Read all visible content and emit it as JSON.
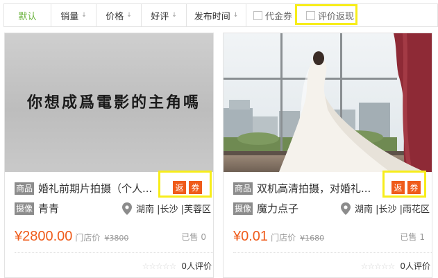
{
  "sort_bar": {
    "default": "默认",
    "sales": "销量",
    "price": "价格",
    "rating": "好评",
    "publish_time": "发布时间",
    "voucher": "代金券",
    "review_cashback": "评价返现"
  },
  "icons": {
    "sort_arrow": "↓",
    "location_pin": "location-pin-icon",
    "star": "☆☆☆☆☆"
  },
  "colors": {
    "accent_green": "#6ab33c",
    "price_orange": "#ef5b1a",
    "highlight_yellow": "#f7ed1a",
    "tag_gray": "#8c8c8c"
  },
  "products": [
    {
      "image_text": "你想成爲電影的主角嗎",
      "tag_product": "商品",
      "title": "婚礼前期片拍摄（个人...",
      "badge_return": "返",
      "badge_coupon": "券",
      "tag_photo": "摄像",
      "shop": "青青",
      "location": "湖南 |长沙 |芙蓉区",
      "price": "¥2800.00",
      "price_label": "门店价",
      "original_price": "¥3800",
      "sold_label": "已售",
      "sold_count": "0",
      "stars": "☆☆☆☆☆",
      "reviews": "0人评价"
    },
    {
      "tag_product": "商品",
      "title": "双机高清拍摄，对婚礼...",
      "badge_return": "返",
      "badge_coupon": "券",
      "tag_photo": "摄像",
      "shop": "魔力点子",
      "location": "湖南 |长沙 |雨花区",
      "price": "¥0.01",
      "price_label": "门店价",
      "original_price": "¥1680",
      "sold_label": "已售",
      "sold_count": "1",
      "stars": "☆☆☆☆☆",
      "reviews": "0人评价"
    }
  ]
}
